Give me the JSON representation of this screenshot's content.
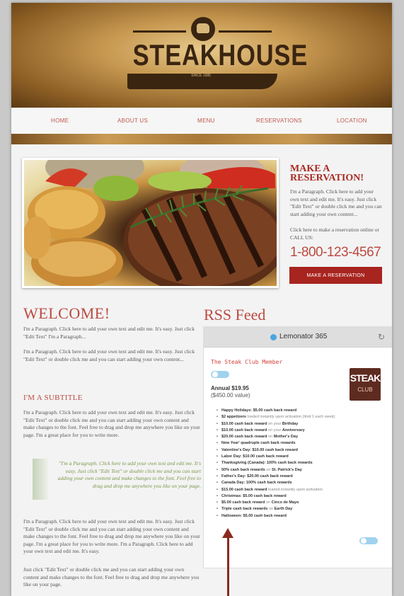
{
  "logo": {
    "title": "STEAKHOUSE",
    "since": "SINCE 1985"
  },
  "nav": [
    "HOME",
    "ABOUT US",
    "MENU",
    "RESERVATIONS",
    "LOCATION"
  ],
  "reservation": {
    "title_line1": "MAKE A",
    "title_line2": "RESERVATION!",
    "text1": "I'm a Paragraph. Click here to add your own text and edit me. It's easy. Just click \"Edit Text\" or double click me and you can start adding your own content...",
    "text2": "Click here to make a reservation online or CALL US:",
    "phone": "1-800-123-4567",
    "button": "MAKE A RESERVATION"
  },
  "welcome": {
    "title": "WELCOME!",
    "p1": "I'm a Paragraph. Click here to add your own text and edit me. It's easy. Just click \"Edit Text\" I'm a Paragraph...",
    "p2": "I'm a Paragraph. Click here to add your own text and edit me. It's easy. Just click \"Edit Text\" or double click me and you can start adding your own content..."
  },
  "subtitle": {
    "title": "I'M A SUBTITLE",
    "p": "I'm a Paragraph. Click here to add your own text and edit me. It's easy. Just click \"Edit Text\" or double click me and you can start adding your own content and make changes to the font. Feel free to drag and drop me anywhere you like on your page. I'm a great place for you to write more.",
    "quote": "\"I'm a Paragraph. Click here to add your own text and edit me. It's easy. Just click \"Edit Text\" or double click me and you can start adding your own content and make changes to the font. Feel free to drag and drop me anywhere you like on your page.",
    "p3": "I'm a Paragraph. Click here to add your own text and edit me. It's easy. Just click \"Edit Text\" or double click me and you can start adding your own content and make changes to the font. Feel free to drag and drop me anywhere you like on your page. I'm a great place for you to write more. I'm a Paragraph. Click here to add your own text and edit me. It's easy.",
    "p4": "Just click \"Edit Text\" or double click me and you can start adding your own content and make changes to the font. Feel free to drag and drop me anywhere you like on your page."
  },
  "rss": {
    "title": "RSS Feed",
    "feed_name": "Lemonator 365",
    "refresh_icon": "refresh-icon",
    "club_title": "The Steak Club Member",
    "price": "Annual $19.95",
    "value": "($450.00 value)",
    "logo_text": "STEAK",
    "logo_sub": "CLUB",
    "rewards": [
      {
        "a": "Happy Holidays: $5.00 cash back reward",
        "b": ""
      },
      {
        "a": "$2 appetizers",
        "b": " loaded instantly upon activation (limit 1 each week)"
      },
      {
        "a": "$10.00 cash back reward",
        "b": " on your ",
        "c": "Birthday"
      },
      {
        "a": "$10.00 cash back reward",
        "b": " on your ",
        "c": "Anniversary"
      },
      {
        "a": "$20.00 cash back reward",
        "b": " on ",
        "c": "Mother's Day"
      },
      {
        "a": "New Year' quadruple cash back rewards",
        "b": ""
      },
      {
        "a": "Valentine's Day: $10.00 cash back reward",
        "b": ""
      },
      {
        "a": "Labor Day: $10.00 cash back reward",
        "b": ""
      },
      {
        "a": "Thanksgiving (Canada): 100% cash back rewards",
        "b": ""
      },
      {
        "a": "50% cash back rewards",
        "b": " on ",
        "c": "St. Patrick's Day"
      },
      {
        "a": "Father's Day: $20.00 cash back reward",
        "b": ""
      },
      {
        "a": "Canada Day: 100% cash back rewards",
        "b": ""
      },
      {
        "a": "$15.00 cash back reward",
        "b": " loaded instantly upon activation"
      },
      {
        "a": "Christmas: $5.00 cash back reward",
        "b": ""
      },
      {
        "a": "$5.00 cash back reward",
        "b": " on ",
        "c": "Cinco de Mayo"
      },
      {
        "a": "Triple cash back rewards",
        "b": " on ",
        "c": "Earth Day"
      },
      {
        "a": "Halloween: $5.00 cash back reward",
        "b": ""
      }
    ]
  }
}
